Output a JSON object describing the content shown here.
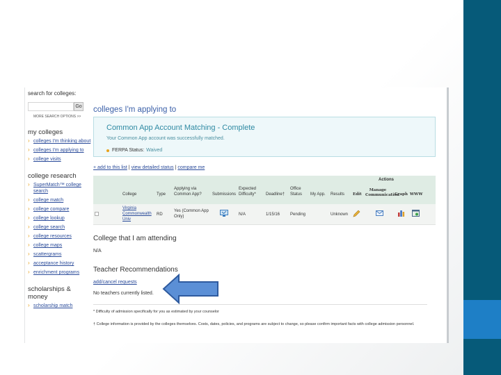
{
  "sidebar": {
    "search_label": "search for colleges:",
    "search_placeholder": "",
    "go_label": "Go",
    "more_search": "MORE SEARCH OPTIONS >>",
    "sections": [
      {
        "title": "my colleges",
        "items": [
          "colleges I'm thinking about",
          "colleges I'm applying to",
          "college visits"
        ]
      },
      {
        "title": "college research",
        "items": [
          "SuperMatch™ college search",
          "college match",
          "college compare",
          "college lookup",
          "college search",
          "college resources",
          "college maps",
          "scattergrams",
          "acceptance history",
          "enrichment programs"
        ]
      },
      {
        "title": "scholarships & money",
        "items": [
          "scholarship match"
        ]
      }
    ]
  },
  "main": {
    "title": "colleges I'm applying to",
    "match_box": {
      "title": "Common App Account Matching",
      "status": " - Complete",
      "message": "Your Common App account was successfully matched.",
      "ferpa_label": "FERPA Status:",
      "ferpa_value": "Waived"
    },
    "links": {
      "add": "+ add to this list",
      "sep1": " | ",
      "view": "view detailed status",
      "sep2": " | ",
      "compare": "compare me"
    },
    "table": {
      "actions_label": "Actions",
      "headers": {
        "college": "College",
        "type": "Type",
        "applying_via": "Applying via Common App?",
        "submissions": "Submissions",
        "difficulty": "Expected Difficulty*",
        "deadline": "Deadline†",
        "office_status": "Office Status",
        "my_app": "My App.",
        "results": "Results",
        "edit": "Edit",
        "manage": "Manage Communication",
        "graph": "Graph",
        "www": "WWW"
      },
      "row": {
        "college": "Virginia Commonwealth Univ",
        "type": "RD",
        "applying_via": "Yes (Common App Only)",
        "difficulty": "N/A",
        "deadline": "1/15/16",
        "office_status": "Pending",
        "results": "Unknown"
      }
    },
    "attending_title": "College that I am attending",
    "attending_value": "N/A",
    "teacher_title": "Teacher Recommendations",
    "teacher_link": "add/cancel requests",
    "teacher_none": "No teachers currently listed.",
    "footnote1": "* Difficulty of admission specifically for you as estimated by your counselor",
    "footnote2": "† College information is provided by the colleges themselves. Costs, dates, policies, and programs are subject to change, so please confirm important facts with college admission personnel."
  },
  "colors": {
    "band": "#065a79",
    "accent": "#1e7fc6",
    "arrow": "#5b8fd6",
    "link": "#2a4b9a",
    "teal": "#2f8aa3"
  }
}
